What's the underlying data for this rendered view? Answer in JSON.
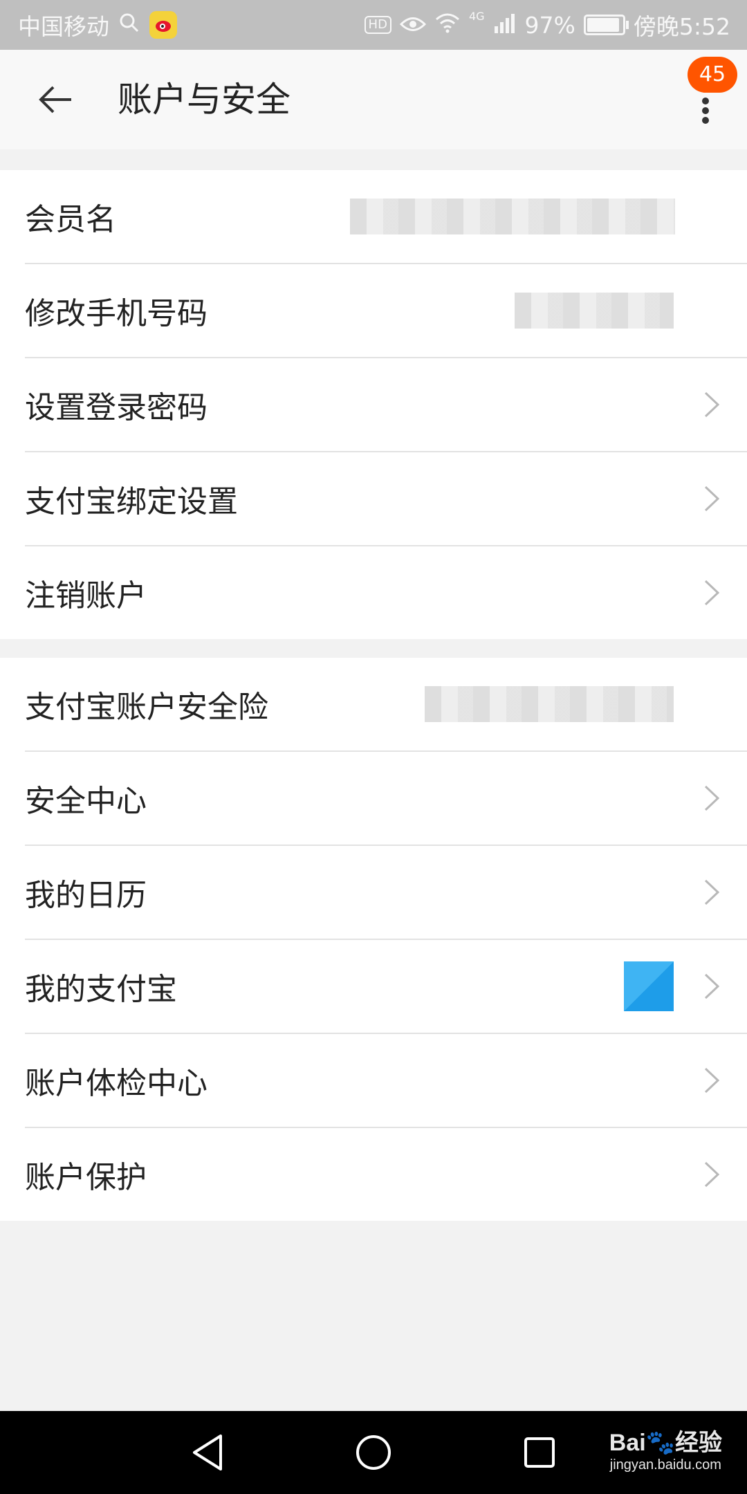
{
  "status_bar": {
    "carrier": "中国移动",
    "battery_percent": "97%",
    "network": "4G",
    "time": "傍晚5:52",
    "hd_label": "HD"
  },
  "app_bar": {
    "title": "账户与安全",
    "badge_count": "45",
    "back_icon": "back-arrow-icon",
    "more_icon": "more-vert-icon"
  },
  "groups": [
    {
      "items": [
        {
          "label": "会员名"
        },
        {
          "label": "修改手机号码"
        },
        {
          "label": "设置登录密码"
        },
        {
          "label": "支付宝绑定设置"
        },
        {
          "label": "注销账户"
        }
      ]
    },
    {
      "items": [
        {
          "label": "支付宝账户安全险"
        },
        {
          "label": "安全中心"
        },
        {
          "label": "我的日历"
        },
        {
          "label": "我的支付宝"
        },
        {
          "label": "账户体检中心"
        },
        {
          "label": "账户保护"
        }
      ]
    }
  ],
  "watermark": {
    "brand": "Bai",
    "brand_suffix": "经验",
    "url": "jingyan.baidu.com"
  },
  "colors": {
    "accent": "#ff5500",
    "status_bar": "#bfbfbf",
    "background": "#f2f2f2"
  }
}
